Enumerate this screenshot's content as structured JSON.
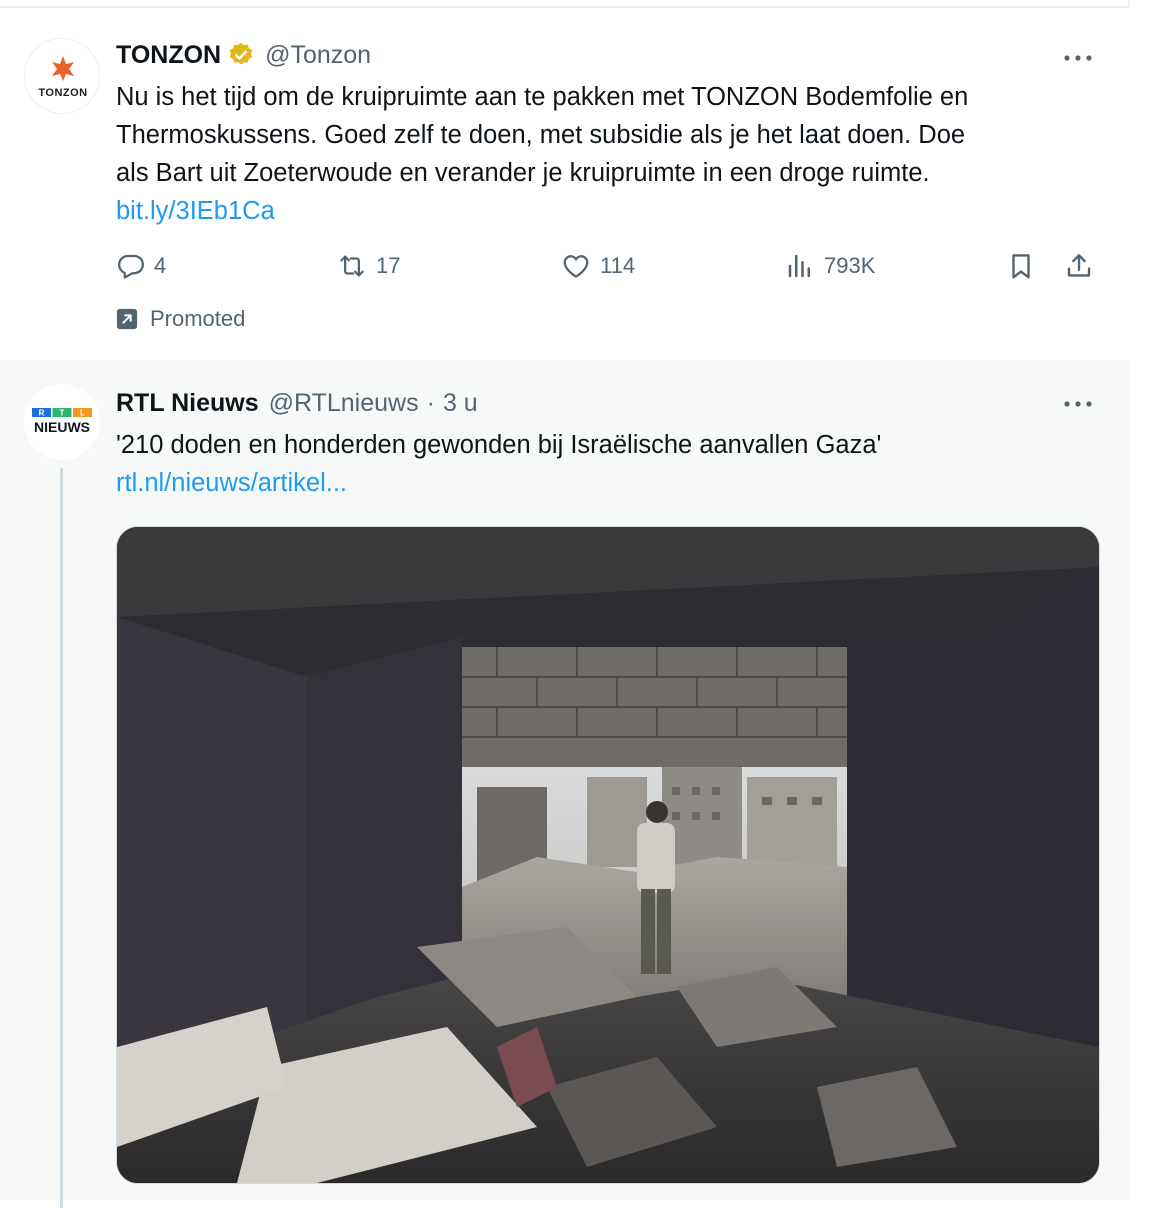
{
  "promoted_tweet": {
    "avatar_text": "TONZON",
    "name": "TONZON",
    "handle": "@Tonzon",
    "text_lines": [
      "Nu is het tijd om de kruipruimte aan te pakken met TONZON Bodemfolie en",
      "Thermoskussens. Goed zelf te doen, met subsidie als je het laat doen. Doe",
      "als Bart uit Zoeterwoude en verander je kruipruimte in een droge ruimte."
    ],
    "link": "bit.ly/3IEb1Ca",
    "replies": "4",
    "retweets": "17",
    "likes": "114",
    "views": "793K",
    "promoted_label": "Promoted",
    "icons": [
      "verified-badge-icon",
      "more-icon",
      "reply-icon",
      "retweet-icon",
      "like-icon",
      "views-icon",
      "bookmark-icon",
      "share-icon",
      "promoted-arrow-icon"
    ]
  },
  "news_tweet": {
    "avatar_text": "NIEUWS",
    "avatar_letters": [
      "R",
      "T",
      "L"
    ],
    "name": "RTL Nieuws",
    "handle": "@RTLnieuws",
    "separator": "·",
    "time": "3 u",
    "text": "'210 doden en honderden gewonden bij Israëlische aanvallen Gaza'",
    "link": "rtl.nl/nieuws/artikel...",
    "media_description_icon": "photo-icon"
  },
  "colors": {
    "accent": "#1d9bf0",
    "text": "#0f1419",
    "muted": "#536471",
    "verified_gold": "#e2b719",
    "tonzon_orange": "#e8622c"
  }
}
